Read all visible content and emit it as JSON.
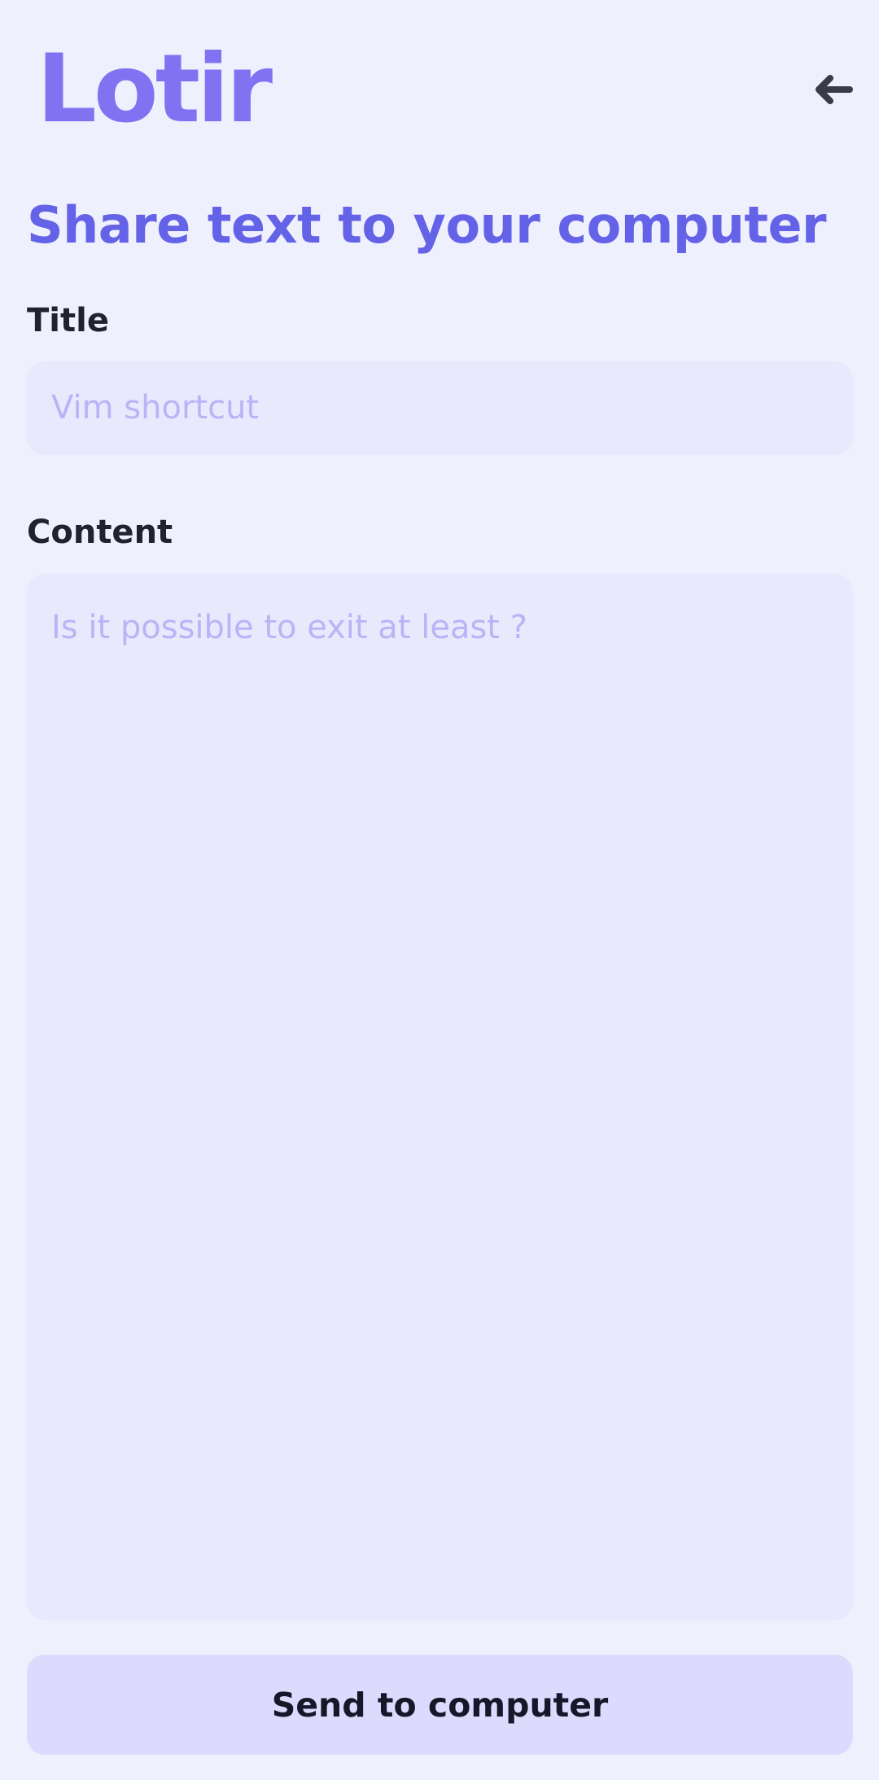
{
  "header": {
    "logo_text": "Lotir",
    "back_icon": "arrow-left-icon"
  },
  "page": {
    "heading": "Share text to your computer"
  },
  "form": {
    "title_label": "Title",
    "title_placeholder": "Vim shortcut",
    "title_value": "",
    "content_label": "Content",
    "content_placeholder": "Is it possible to exit at least ?",
    "content_value": "",
    "submit_label": "Send to computer"
  },
  "colors": {
    "background": "#eff0fe",
    "logo": "#7f73f2",
    "heading": "#6462e6",
    "field_background": "#e9e8fd",
    "placeholder": "#bab4f6",
    "button_background": "#dcdbfd",
    "label_text": "#22222e"
  }
}
